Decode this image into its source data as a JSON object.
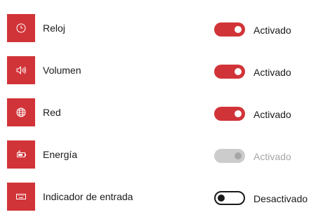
{
  "colors": {
    "accent": "#d13438",
    "text": "#1a1a1a",
    "disabled_track": "#cccccc",
    "disabled_text": "#a6a6a6"
  },
  "items": [
    {
      "label": "Reloj",
      "icon": "clock-icon",
      "state": "on",
      "status": "Activado"
    },
    {
      "label": "Volumen",
      "icon": "volume-icon",
      "state": "on",
      "status": "Activado"
    },
    {
      "label": "Red",
      "icon": "network-globe-icon",
      "state": "on",
      "status": "Activado"
    },
    {
      "label": "Energía",
      "icon": "battery-icon",
      "state": "disabled",
      "status": "Activado"
    },
    {
      "label": "Indicador de entrada",
      "icon": "keyboard-icon",
      "state": "off",
      "status": "Desactivado"
    }
  ]
}
